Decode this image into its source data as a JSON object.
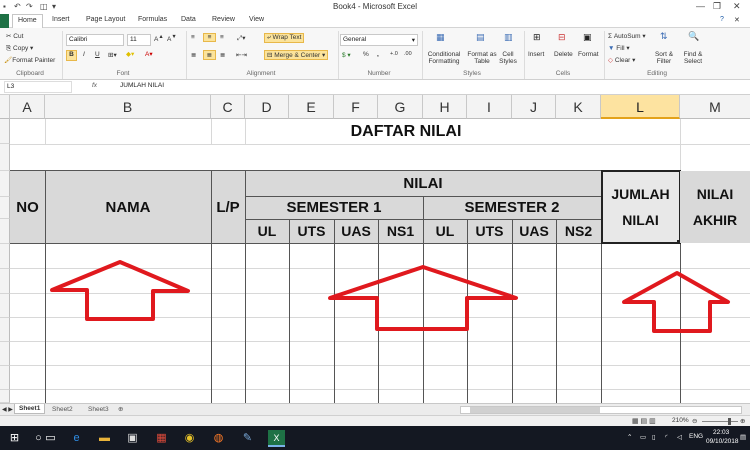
{
  "window": {
    "title": "Book4  -  Microsoft Excel"
  },
  "ribbon": {
    "tabs": [
      "Home",
      "Insert",
      "Page Layout",
      "Formulas",
      "Data",
      "Review",
      "View"
    ],
    "clipboard": {
      "cut": "Cut",
      "copy": "Copy",
      "format_painter": "Format Painter",
      "group": "Clipboard"
    },
    "font": {
      "name": "Calibri",
      "size": "11",
      "group": "Font"
    },
    "alignment": {
      "wrap": "Wrap Text",
      "merge": "Merge & Center",
      "group": "Alignment"
    },
    "number": {
      "format": "General",
      "group": "Number"
    },
    "styles": {
      "conditional": "Conditional Formatting",
      "format_table": "Format as Table",
      "cell_styles": "Cell Styles",
      "group": "Styles"
    },
    "cells": {
      "insert": "Insert",
      "delete": "Delete",
      "format": "Format",
      "group": "Cells"
    },
    "editing": {
      "autosum": "AutoSum",
      "fill": "Fill",
      "clear": "Clear",
      "sort": "Sort & Filter",
      "find": "Find & Select",
      "group": "Editing"
    }
  },
  "formula_bar": {
    "name_box": "L3",
    "fx": "fx",
    "content": "JUMLAH NILAI"
  },
  "columns": [
    "A",
    "B",
    "C",
    "D",
    "E",
    "F",
    "G",
    "H",
    "I",
    "J",
    "K",
    "L",
    "M"
  ],
  "selected_column": "L",
  "table": {
    "title": "DAFTAR NILAI",
    "no": "NO",
    "nama": "NAMA",
    "lp": "L/P",
    "nilai": "NILAI",
    "semester1": "SEMESTER 1",
    "semester2": "SEMESTER 2",
    "sub1": [
      "UL",
      "UTS",
      "UAS",
      "NS1"
    ],
    "sub2": [
      "UL",
      "UTS",
      "UAS",
      "NS2"
    ],
    "jumlah": [
      "JUMLAH",
      "NILAI"
    ],
    "akhir": [
      "NILAI",
      "AKHIR"
    ]
  },
  "sheets": [
    "Sheet1",
    "Sheet2",
    "Sheet3"
  ],
  "active_sheet": "Sheet1",
  "status": {
    "zoom": "210%"
  },
  "taskbar": {
    "language": "ENG",
    "time": "22:03",
    "date": "09/10/2018"
  },
  "colors": {
    "selected_column": "#fde3a0",
    "header_fill": "#d9d9d9",
    "arrow": "#e0191e",
    "excel_green": "#1e7145"
  }
}
